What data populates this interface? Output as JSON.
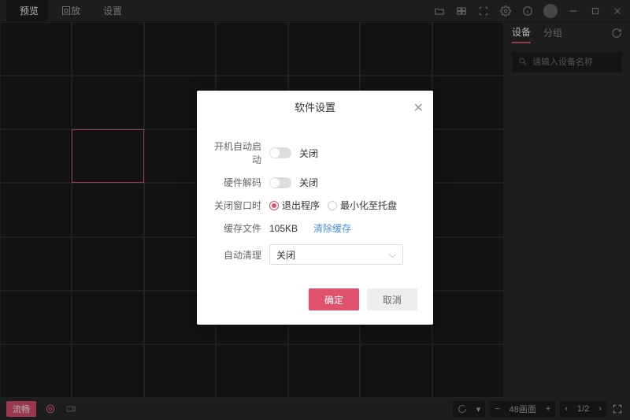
{
  "topbar": {
    "tabs": [
      {
        "label": "预览",
        "icon": "play-circle"
      },
      {
        "label": "回放",
        "icon": "film"
      },
      {
        "label": "设置",
        "icon": "gear"
      }
    ]
  },
  "sidebar": {
    "tabs": {
      "device": "设备",
      "group": "分组"
    },
    "search_placeholder": "请输入设备名称"
  },
  "bottom": {
    "quality_badge": "流畅",
    "layout_label": "48画面",
    "page_current": "1/2"
  },
  "dialog": {
    "title": "软件设置",
    "rows": {
      "autostart": {
        "label": "开机自动启动",
        "state": "关闭"
      },
      "hwdecode": {
        "label": "硬件解码",
        "state": "关闭"
      },
      "closewin": {
        "label": "关闭窗口时",
        "opt_exit": "退出程序",
        "opt_tray": "最小化至托盘"
      },
      "cache": {
        "label": "缓存文件",
        "size": "105KB",
        "clear": "清除缓存"
      },
      "autoclean": {
        "label": "自动清理",
        "value": "关闭"
      }
    },
    "buttons": {
      "ok": "确定",
      "cancel": "取消"
    }
  }
}
